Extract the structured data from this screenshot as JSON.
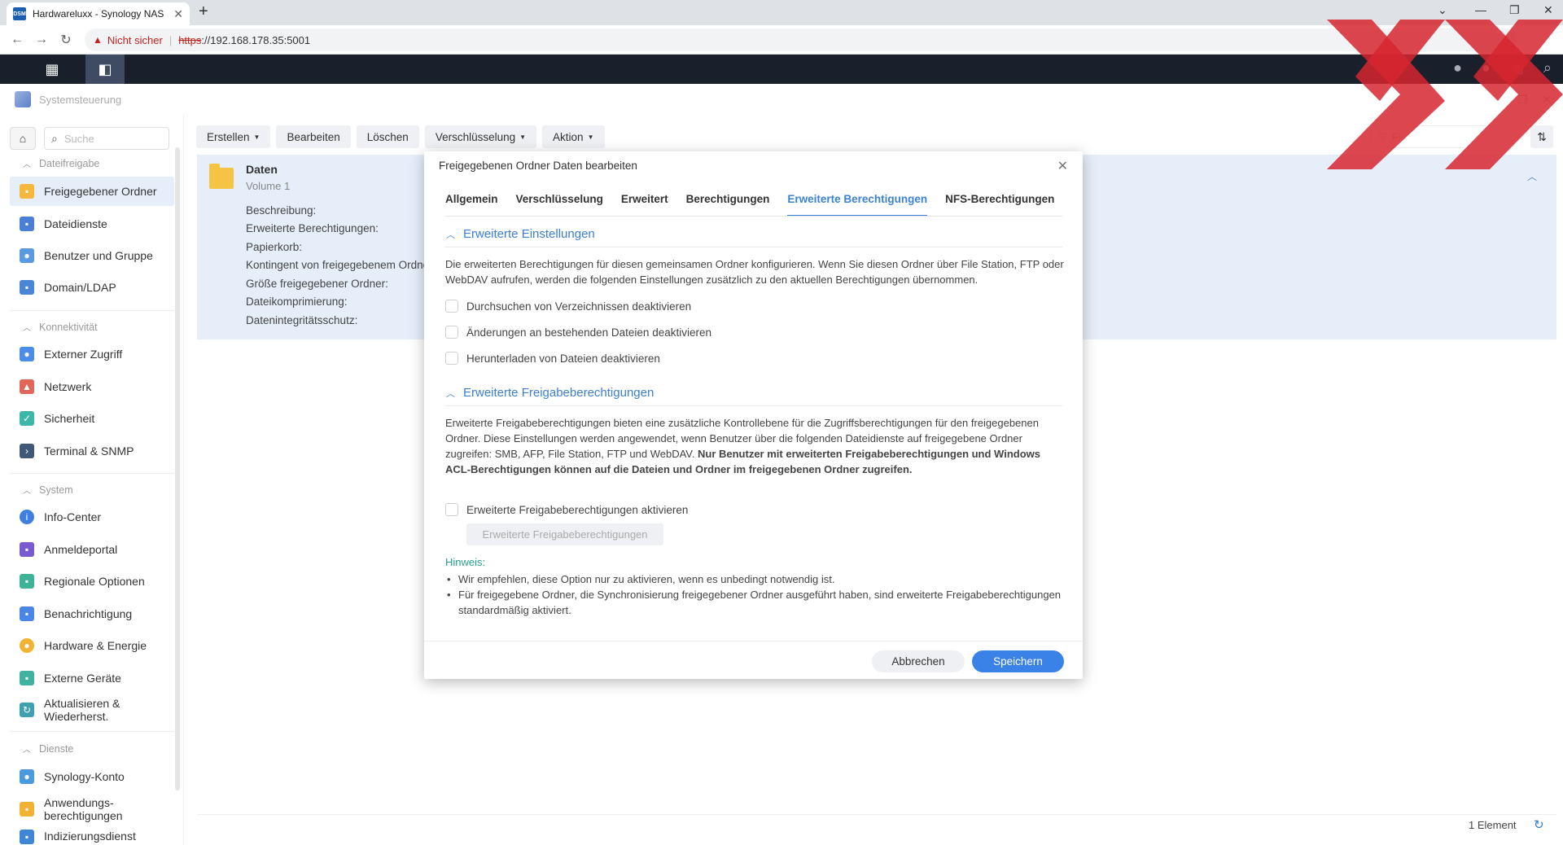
{
  "browser": {
    "tab_title": "Hardwareluxx - Synology NAS",
    "favicon_text": "DSM",
    "not_secure": "Nicht sicher",
    "url_scheme": "https",
    "url_rest": "://192.168.178.35:5001"
  },
  "window": {
    "title": "Systemsteuerung"
  },
  "sidebar": {
    "search_placeholder": "Suche",
    "sections": {
      "file_sharing": "Dateifreigabe",
      "connectivity": "Konnektivität",
      "system": "System",
      "services": "Dienste"
    },
    "items": {
      "shared_folder": "Freigegebener Ordner",
      "file_services": "Dateidienste",
      "user_group": "Benutzer und Gruppe",
      "domain_ldap": "Domain/LDAP",
      "external_access": "Externer Zugriff",
      "network": "Netzwerk",
      "security": "Sicherheit",
      "terminal_snmp": "Terminal & SNMP",
      "info_center": "Info-Center",
      "login_portal": "Anmeldeportal",
      "regional": "Regionale Optionen",
      "notification": "Benachrichtigung",
      "hardware_power": "Hardware & Energie",
      "external_devices": "Externe Geräte",
      "update_restore_1": "Aktualisieren &",
      "update_restore_2": "Wiederherst.",
      "synology_account": "Synology-Konto",
      "app_privileges_1": "Anwendungs-",
      "app_privileges_2": "berechtigungen",
      "indexing": "Indizierungsdienst"
    }
  },
  "toolbar": {
    "create": "Erstellen",
    "edit": "Bearbeiten",
    "delete": "Löschen",
    "encryption": "Verschlüsselung",
    "action": "Aktion",
    "filter_placeholder": "Fi"
  },
  "folder": {
    "name": "Daten",
    "volume": "Volume 1",
    "labels": [
      "Beschreibung:",
      "Erweiterte Berechtigungen:",
      "Papierkorb:",
      "Kontingent von freigegebenem Ordner:",
      "Größe freigegebener Ordner:",
      "Dateikomprimierung:",
      "Datenintegritätsschutz:"
    ]
  },
  "status": {
    "count": "1 Element"
  },
  "dialog": {
    "title": "Freigegebenen Ordner Daten bearbeiten",
    "tabs": [
      "Allgemein",
      "Verschlüsselung",
      "Erweitert",
      "Berechtigungen",
      "Erweiterte Berechtigungen",
      "NFS-Berechtigungen"
    ],
    "section1_title": "Erweiterte Einstellungen",
    "section1_text": "Die erweiterten Berechtigungen für diesen gemeinsamen Ordner konfigurieren. Wenn Sie diesen Ordner über File Station, FTP oder WebDAV aufrufen, werden die folgenden Einstellungen zusätzlich zu den aktuellen Berechtigungen übernommen.",
    "check1": "Durchsuchen von Verzeichnissen deaktivieren",
    "check2": "Änderungen an bestehenden Dateien deaktivieren",
    "check3": "Herunterladen von Dateien deaktivieren",
    "section2_title": "Erweiterte Freigabeberechtigungen",
    "section2_text_normal": "Erweiterte Freigabeberechtigungen bieten eine zusätzliche Kontrollebene für die Zugriffsberechtigungen für den freigegebenen Ordner. Diese Einstellungen werden angewendet, wenn Benutzer über die folgenden Dateidienste auf freigegebene Ordner zugreifen: SMB, AFP, File Station, FTP und WebDAV. ",
    "section2_text_bold": "Nur Benutzer mit erweiterten Freigabeberechtigungen und Windows ACL-Berechtigungen können auf die Dateien und Ordner im freigegebenen Ordner zugreifen.",
    "check4": "Erweiterte Freigabeberechtigungen aktivieren",
    "disabled_button": "Erweiterte Freigabeberechtigungen",
    "hint_title": "Hinweis:",
    "hint1": "Wir empfehlen, diese Option nur zu aktivieren, wenn es unbedingt notwendig ist.",
    "hint2": "Für freigegebene Ordner, die Synchronisierung freigegebener Ordner ausgeführt haben, sind erweiterte Freigabeberechtigungen standardmäßig aktiviert.",
    "cancel": "Abbrechen",
    "save": "Speichern"
  }
}
